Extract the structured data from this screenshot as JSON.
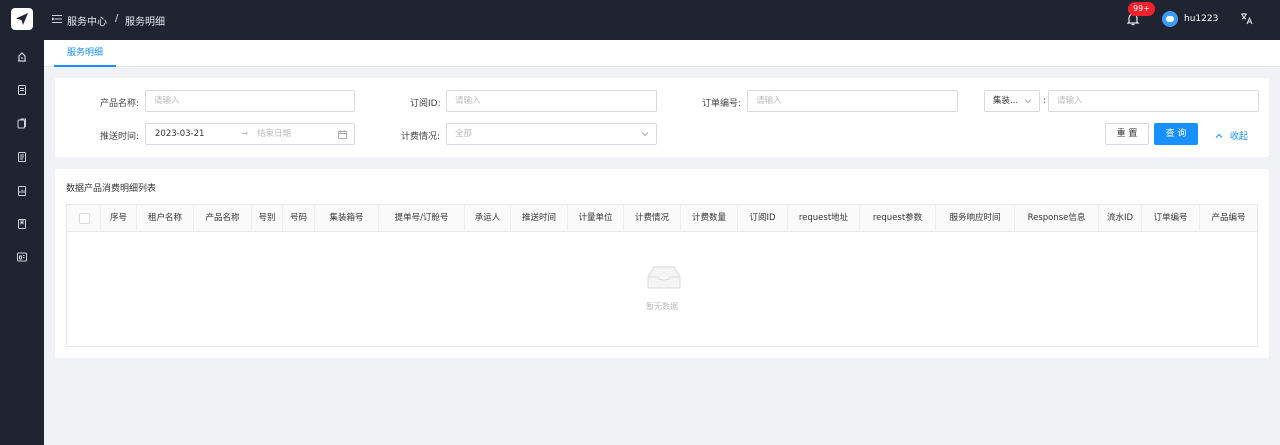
{
  "header": {
    "breadcrumb": [
      "服务中心",
      "服务明细"
    ],
    "breadcrumb_sep": "/",
    "notification_badge": "99+",
    "username": "hu1223"
  },
  "tabs": [
    {
      "label": "服务明细",
      "active": true
    }
  ],
  "filters": {
    "product_name": {
      "label": "产品名称:",
      "placeholder": "请输入"
    },
    "subscription_id": {
      "label": "订阅ID:",
      "placeholder": "请输入"
    },
    "order_no": {
      "label": "订单编号:",
      "placeholder": "请输入"
    },
    "container_select": {
      "label": "集装...",
      "colon": ":",
      "placeholder": "请输入"
    },
    "push_time": {
      "label": "推送时间:",
      "start": "2023-03-21",
      "arrow": "→",
      "end_placeholder": "结束日期"
    },
    "billing": {
      "label": "计费情况:",
      "placeholder": "全部"
    }
  },
  "buttons": {
    "reset": "重 置",
    "query": "查 询",
    "collapse": "收起"
  },
  "table": {
    "title": "数据产品消费明细列表",
    "columns": [
      "序号",
      "租户名称",
      "产品名称",
      "号别",
      "号码",
      "集装箱号",
      "提单号/订舱号",
      "承运人",
      "推送时间",
      "计量单位",
      "计费情况",
      "计费数量",
      "订阅ID",
      "request地址",
      "request参数",
      "服务响应时间",
      "Response信息",
      "流水ID",
      "订单编号",
      "产品编号"
    ],
    "empty_text": "暂无数据"
  },
  "colors": {
    "accent": "#1890ff",
    "dark": "#1f2430",
    "badge": "#f5222d"
  }
}
